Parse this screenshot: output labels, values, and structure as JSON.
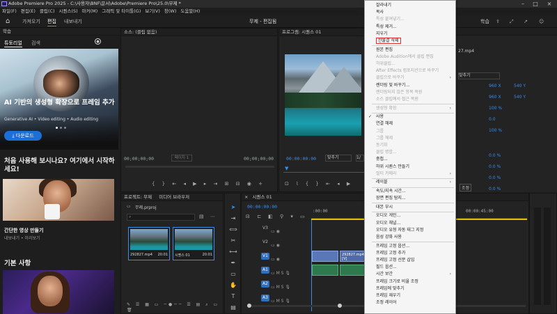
{
  "window": {
    "title": "Adobe Premiere Pro 2025 - C:\\사용자\\BNF\\문서\\Adobe\\Premiere Pro\\25.0\\무제 *",
    "project_title": "무제 - 편집됨"
  },
  "menubar": [
    "파일(F)",
    "편집(E)",
    "클립(C)",
    "시퀀스(S)",
    "마커(M)",
    "그래픽 및 타이틀(G)",
    "보기(V)",
    "창(W)",
    "도움말(H)"
  ],
  "workspace": {
    "tabs": [
      "가져오기",
      "편집",
      "내보내기"
    ],
    "active_tab": "편집",
    "right_label": "학습"
  },
  "learn_panel": {
    "header": "학습",
    "tabs": [
      "튜토리얼",
      "검색"
    ],
    "hero_title": "AI 기반의 생성형 확장으로 프레임 추가",
    "hero_sub": "Generative AI • Video editing • Audio editing",
    "download_button": "다운로드",
    "question": "처음 사용해 보시나요? 여기에서 시작하세요!",
    "card_title": "간단한 영상 만들기",
    "card_sub": "내보내기 • 미리보기",
    "section": "기본 사항"
  },
  "source_panel": {
    "header": "소스: (클립 없음)",
    "timecode_left": "00;00;00;00",
    "page": "페이지 1",
    "timecode_right": "00;00;00;00"
  },
  "program_panel": {
    "header": "프로그램: 시퀀스 01",
    "timecode": "00:00:00:00",
    "fit": "맞추기",
    "quality": "1/"
  },
  "effect_controls": {
    "clip": "27.mp4",
    "fit": "맞추기",
    "values": [
      [
        "960 X",
        "540 Y"
      ],
      [
        "960 X",
        "540 Y"
      ],
      [
        "100 %",
        ""
      ],
      [
        "0.0",
        ""
      ],
      [
        "100 %",
        ""
      ],
      [
        "0.0 %",
        ""
      ],
      [
        "0.0 %",
        ""
      ],
      [
        "0.0 %",
        ""
      ],
      [
        "0.0 %",
        ""
      ]
    ],
    "bottom_label": "조정"
  },
  "project_panel": {
    "tabs": [
      "프로젝트: 무제",
      "미디어 브라우저"
    ],
    "filename": "무제.prproj",
    "items": [
      {
        "name": "292827.mp4",
        "duration": "20:01"
      },
      {
        "name": "시퀀스 01",
        "duration": "20:01"
      }
    ]
  },
  "timeline": {
    "tab": "시퀀스 01",
    "timecode": "00:00:00:00",
    "ruler": [
      ":00:00",
      "00:00:45:00"
    ],
    "tracks": [
      "V3",
      "V2",
      "V1",
      "A1",
      "A2",
      "A3"
    ],
    "clip_label": "292827.mp4 [V]"
  },
  "context_menu": {
    "items": [
      {
        "label": "잘라내기",
        "disabled": false
      },
      {
        "label": "복사",
        "disabled": false
      },
      {
        "label": "특성 붙여넣기...",
        "disabled": true
      },
      {
        "label": "특성 제거...",
        "disabled": false
      },
      {
        "label": "지우기",
        "disabled": false
      },
      {
        "label": "잔물결 삭제",
        "disabled": false,
        "highlighted": true
      },
      {
        "sep": true
      },
      {
        "label": "원본 편집",
        "disabled": false
      },
      {
        "label": "Adobe Audition에서 클립 편집",
        "disabled": true
      },
      {
        "label": "하위클립...",
        "disabled": true
      },
      {
        "label": "After Effects 컴포지션으로 바꾸기",
        "disabled": true
      },
      {
        "label": "클립으로 바꾸기",
        "disabled": true,
        "submenu": true
      },
      {
        "label": "렌더링 및 바꾸기...",
        "disabled": false
      },
      {
        "label": "렌더링되지 않은 항목 복원",
        "disabled": true
      },
      {
        "label": "소스 클립에서 접근 복원",
        "disabled": true
      },
      {
        "sep": true
      },
      {
        "label": "생성형 확장",
        "disabled": true,
        "submenu": true
      },
      {
        "sep": true
      },
      {
        "label": "사용",
        "disabled": false,
        "checked": true
      },
      {
        "label": "연결 해제",
        "disabled": false
      },
      {
        "label": "그룹",
        "disabled": true
      },
      {
        "label": "그룹 해제",
        "disabled": true
      },
      {
        "label": "동기화",
        "disabled": true
      },
      {
        "label": "클립 병합...",
        "disabled": true
      },
      {
        "label": "중첩...",
        "disabled": false
      },
      {
        "label": "하위 시퀀스 만들기",
        "disabled": false
      },
      {
        "label": "멀티 카메라",
        "disabled": true,
        "submenu": true
      },
      {
        "sep": true
      },
      {
        "label": "레이블",
        "disabled": false,
        "submenu": true
      },
      {
        "sep": true
      },
      {
        "label": "속도/지속 시간...",
        "disabled": false
      },
      {
        "label": "장면 편집 탐지...",
        "disabled": false
      },
      {
        "sep": true
      },
      {
        "label": "대본 부시",
        "disabled": false
      },
      {
        "sep": true
      },
      {
        "label": "오디오 게인...",
        "disabled": false
      },
      {
        "label": "오디오 채널...",
        "disabled": false
      },
      {
        "label": "오디오 유형 자동 태그 지정",
        "disabled": false
      },
      {
        "label": "음성 강화 사용",
        "disabled": false
      },
      {
        "sep": true
      },
      {
        "label": "프레임 고정 옵션...",
        "disabled": false
      },
      {
        "label": "프레임 고정 추가",
        "disabled": false
      },
      {
        "label": "프레임 고정 선분 삽입",
        "disabled": false
      },
      {
        "label": "필드 옵션...",
        "disabled": false
      },
      {
        "label": "시간 보간",
        "disabled": false,
        "submenu": true
      },
      {
        "label": "프레임 크기로 비율 조정",
        "disabled": false
      },
      {
        "label": "프레임에 맞추기",
        "disabled": false
      },
      {
        "label": "프레임 재우기",
        "disabled": false
      },
      {
        "label": "조정 레이어",
        "disabled": false
      }
    ]
  },
  "colors": {
    "accent": "#3a8ee6",
    "highlight_border": "#e03131",
    "video_clip": "#5a78b8",
    "audio_clip": "#2e7a4e"
  }
}
